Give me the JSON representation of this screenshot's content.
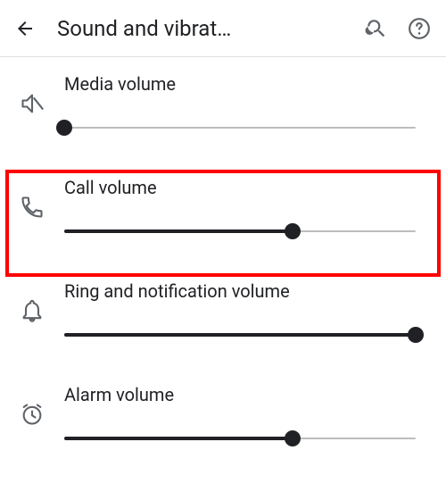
{
  "header": {
    "title": "Sound and vibrat…"
  },
  "rows": [
    {
      "label": "Media volume",
      "value": 0
    },
    {
      "label": "Call volume",
      "value": 65
    },
    {
      "label": "Ring and notification volume",
      "value": 100
    },
    {
      "label": "Alarm volume",
      "value": 65
    }
  ],
  "icons": {
    "back": "back-arrow-icon",
    "search": "search-icon",
    "help": "help-icon",
    "media": "media-mute-icon",
    "call": "phone-icon",
    "ring": "bell-icon",
    "alarm": "alarm-clock-icon"
  }
}
